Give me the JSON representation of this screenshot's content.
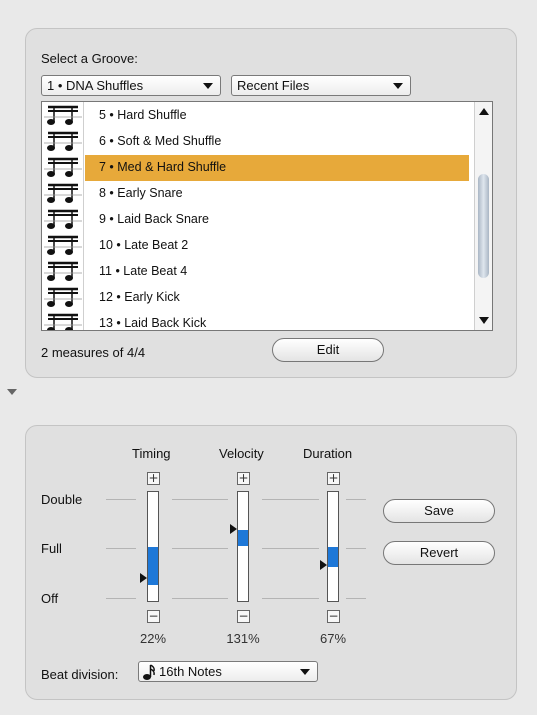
{
  "groove": {
    "select_label": "Select a Groove:",
    "category": {
      "value": "1 • DNA Shuffles",
      "icon": "chevron-down-icon"
    },
    "recent": {
      "value": "Recent Files",
      "icon": "chevron-down-icon"
    },
    "items": [
      {
        "label": "5 • Hard Shuffle"
      },
      {
        "label": "6 • Soft & Med Shuffle"
      },
      {
        "label": "7 • Med & Hard Shuffle",
        "selected": true
      },
      {
        "label": "8 • Early Snare"
      },
      {
        "label": "9 • Laid Back Snare"
      },
      {
        "label": "10 • Late Beat 2"
      },
      {
        "label": "11 • Late Beat 4"
      },
      {
        "label": "12 • Early Kick"
      },
      {
        "label": "13 • Laid Back Kick"
      }
    ],
    "measures": "2 measures of 4/4",
    "edit_label": "Edit",
    "selected_color": "#e7a93a"
  },
  "params": {
    "columns": [
      {
        "key": "timing",
        "label": "Timing",
        "percent": "22%",
        "level": 0.22
      },
      {
        "key": "velocity",
        "label": "Velocity",
        "percent": "131%",
        "level": 0.655
      },
      {
        "key": "duration",
        "label": "Duration",
        "percent": "67%",
        "level": 0.335
      }
    ],
    "rows": {
      "double": "Double",
      "full": "Full",
      "off": "Off"
    },
    "plus": "+",
    "minus": "−",
    "save_label": "Save",
    "revert_label": "Revert",
    "beat_division_label": "Beat division:",
    "beat_division": {
      "value": "16th Notes",
      "icon": "sixteenth-note-icon"
    },
    "fill_color": "#1e78d8"
  }
}
